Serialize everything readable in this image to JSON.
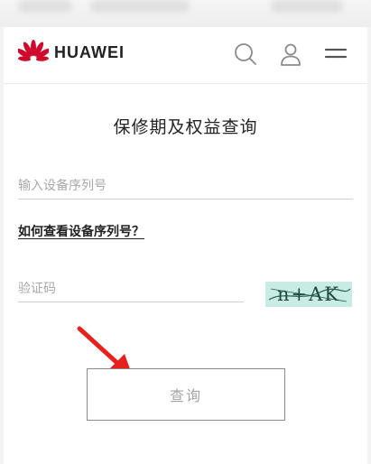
{
  "header": {
    "brand": "HUAWEI",
    "brand_color": "#cf0a2c",
    "icons": [
      "search-icon",
      "user-icon",
      "menu-icon"
    ]
  },
  "form": {
    "title": "保修期及权益查询",
    "serial_placeholder": "输入设备序列号",
    "help_link": "如何查看设备序列号？",
    "captcha_placeholder": "验证码",
    "captcha_text": "n+AK",
    "submit_label": "查询"
  },
  "annotation": {
    "arrow_color": "#e8211f"
  }
}
